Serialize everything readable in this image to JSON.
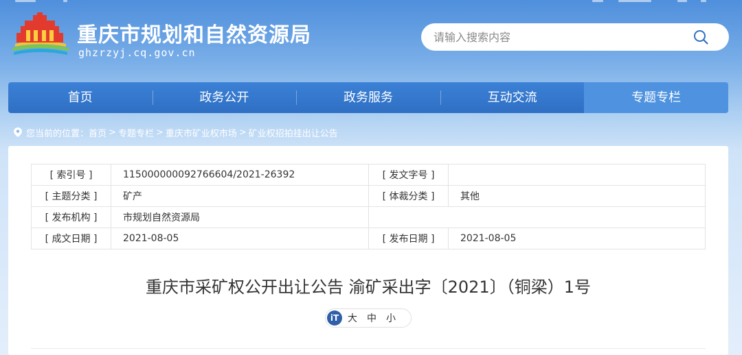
{
  "header": {
    "site_title": "重庆市规划和自然资源局",
    "site_domain": "ghzrzyj.cq.gov.cn"
  },
  "search": {
    "placeholder": "请输入搜索内容"
  },
  "nav": {
    "items": [
      {
        "label": "首页"
      },
      {
        "label": "政务公开"
      },
      {
        "label": "政务服务"
      },
      {
        "label": "互动交流"
      },
      {
        "label": "专题专栏"
      }
    ]
  },
  "breadcrumb": {
    "prefix": "您当前的位置：",
    "items": [
      "首页",
      "专题专栏",
      "重庆市矿业权市场",
      "矿业权招拍挂出让公告"
    ],
    "separator": ">"
  },
  "meta": {
    "index_label": "[ 索引号 ]",
    "index_value": "115000000092766604/2021-26392",
    "doc_no_label": "[ 发文字号 ]",
    "doc_no_value": "",
    "topic_label": "[ 主题分类 ]",
    "topic_value": "矿产",
    "genre_label": "[ 体裁分类 ]",
    "genre_value": "其他",
    "publisher_label": "[ 发布机构 ]",
    "publisher_value": "市规划自然资源局",
    "created_label": "[ 成文日期 ]",
    "created_value": "2021-08-05",
    "published_label": "[ 发布日期 ]",
    "published_value": "2021-08-05"
  },
  "document": {
    "title": "重庆市采矿权公开出让公告 渝矿采出字〔2021〕（铜梁）1号"
  },
  "font_size": {
    "icon_text": "iT",
    "large": "大",
    "medium": "中",
    "small": "小"
  },
  "colors": {
    "nav_bg": "#3277cc",
    "nav_active": "#4f93e0",
    "header_gradient_top": "#4f8fdc",
    "font_icon_bg": "#2f5fa8"
  }
}
